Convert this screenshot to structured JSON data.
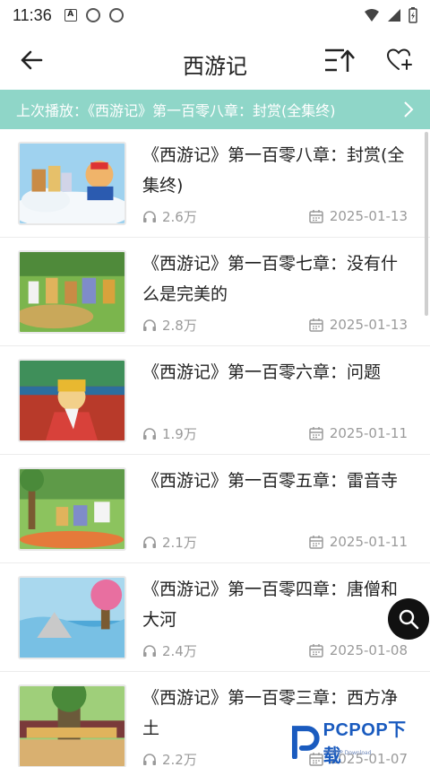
{
  "status_bar": {
    "time": "11:36"
  },
  "header": {
    "title": "西游记"
  },
  "last_played": {
    "text": "上次播放：《西游记》第一百零八章：封赏(全集终)"
  },
  "episodes": [
    {
      "title": "《西游记》第一百零八章：封赏(全集终)",
      "plays": "2.6万",
      "date": "2025-01-13"
    },
    {
      "title": "《西游记》第一百零七章：没有什么是完美的",
      "plays": "2.8万",
      "date": "2025-01-13"
    },
    {
      "title": "《西游记》第一百零六章：问题",
      "plays": "1.9万",
      "date": "2025-01-11"
    },
    {
      "title": "《西游记》第一百零五章：雷音寺",
      "plays": "2.1万",
      "date": "2025-01-11"
    },
    {
      "title": "《西游记》第一百零四章：唐僧和大河",
      "plays": "2.4万",
      "date": "2025-01-08"
    },
    {
      "title": "《西游记》第一百零三章：西方净土",
      "plays": "2.2万",
      "date": "2025-01-07"
    }
  ],
  "watermark": {
    "brand": "PCPOP下载",
    "sub": "PCPOP Download"
  },
  "colors": {
    "accent_banner": "#8fd6c8",
    "text": "#222222",
    "meta": "#9a9a9a"
  },
  "icons": {
    "back": "arrow-left-icon",
    "sort": "sort-icon",
    "favorite": "heart-plus-icon",
    "chevron": "chevron-right-icon",
    "plays": "headphones-icon",
    "date": "calendar-icon",
    "search": "search-icon"
  }
}
